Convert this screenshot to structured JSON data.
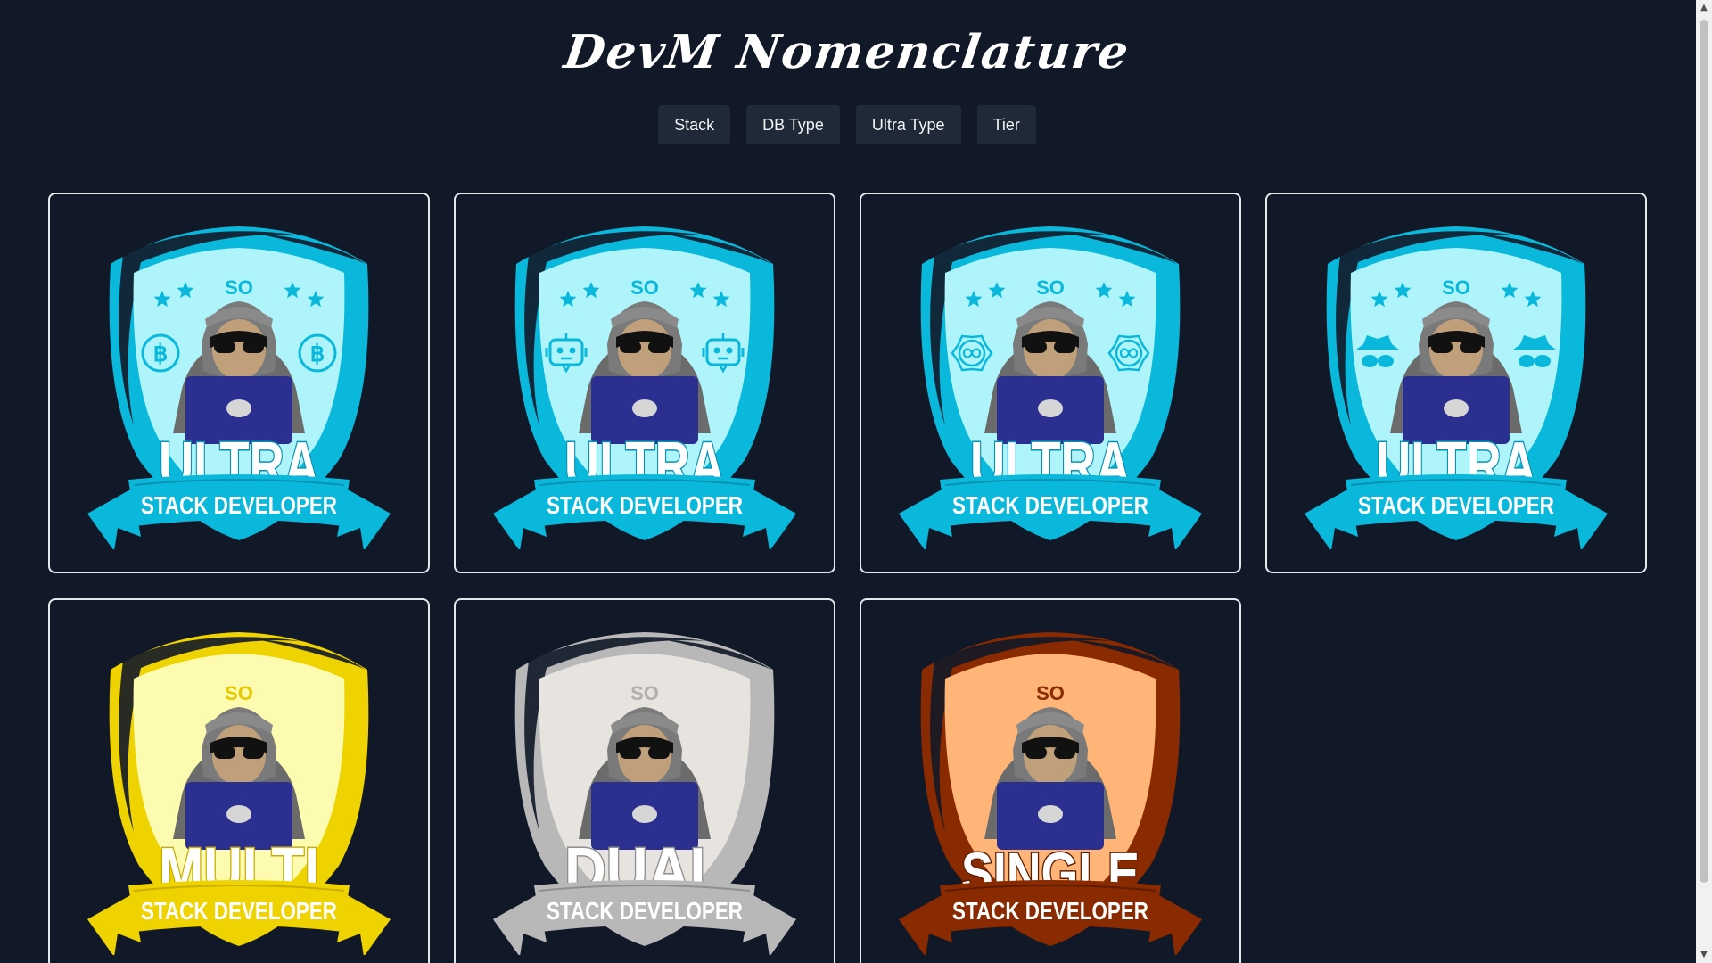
{
  "page": {
    "title": "DevM Nomenclature"
  },
  "filters": [
    {
      "label": "Stack"
    },
    {
      "label": "DB Type"
    },
    {
      "label": "Ultra Type"
    },
    {
      "label": "Tier"
    }
  ],
  "badges": [
    {
      "initials": "SO",
      "tier": "ULTRA",
      "subtitle": "STACK DEVELOPER",
      "theme": "blue",
      "side_icon": "bitcoin-icon",
      "stars": true
    },
    {
      "initials": "SO",
      "tier": "ULTRA",
      "subtitle": "STACK DEVELOPER",
      "theme": "blue",
      "side_icon": "robot-icon",
      "stars": true
    },
    {
      "initials": "SO",
      "tier": "ULTRA",
      "subtitle": "STACK DEVELOPER",
      "theme": "blue",
      "side_icon": "infinity-gear-icon",
      "stars": true
    },
    {
      "initials": "SO",
      "tier": "ULTRA",
      "subtitle": "STACK DEVELOPER",
      "theme": "blue",
      "side_icon": "spy-icon",
      "stars": true
    },
    {
      "initials": "SO",
      "tier": "MULTI",
      "subtitle": "STACK DEVELOPER",
      "theme": "gold",
      "side_icon": "",
      "stars": false
    },
    {
      "initials": "SO",
      "tier": "DUAL",
      "subtitle": "STACK DEVELOPER",
      "theme": "silver",
      "side_icon": "",
      "stars": false
    },
    {
      "initials": "SO",
      "tier": "SINGLE",
      "subtitle": "STACK DEVELOPER",
      "theme": "bronze",
      "side_icon": "",
      "stars": false
    }
  ],
  "themes": {
    "blue": {
      "rim": "#0ab8dc",
      "inner": "#aef4fa",
      "text": "#0ab8dc",
      "ribbon": "#0ab8dc",
      "ribbonDark": "#0891b2"
    },
    "gold": {
      "rim": "#efd300",
      "inner": "#fdfbb0",
      "text": "#e6c800",
      "ribbon": "#efd300",
      "ribbonDark": "#c9ad00"
    },
    "silver": {
      "rim": "#b8b8b8",
      "inner": "#e7e4e0",
      "text": "#b0b0b0",
      "ribbon": "#b8b8b8",
      "ribbonDark": "#8f8f8f"
    },
    "bronze": {
      "rim": "#8a2a00",
      "inner": "#ffb577",
      "text": "#8a2a00",
      "ribbon": "#8a2a00",
      "ribbonDark": "#5f1d00"
    }
  },
  "colors": {
    "background": "#111827",
    "button_bg": "#1f2937",
    "card_border": "#e5e7eb"
  }
}
